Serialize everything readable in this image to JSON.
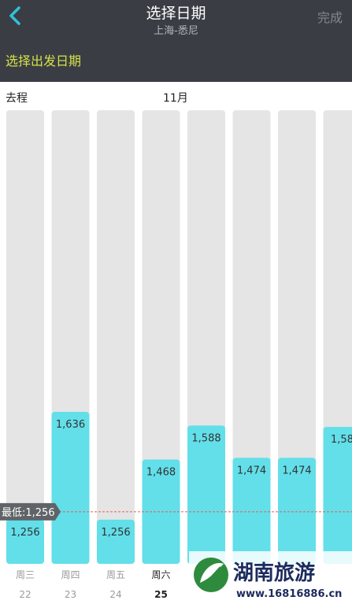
{
  "header": {
    "title": "选择日期",
    "subtitle": "上海-悉尼",
    "done_label": "完成",
    "prompt": "选择出发日期",
    "bg_color": "#3a3e44",
    "accent_color": "#d6e047",
    "back_icon": "chevron-left-icon",
    "back_icon_color": "#2ec3d8"
  },
  "section": {
    "leg_label": "去程",
    "month_label": "11月"
  },
  "lowest_tag": {
    "label": "最低:1,256"
  },
  "chart_data": {
    "type": "bar",
    "days": [
      "周三",
      "周四",
      "周五",
      "周六",
      "",
      "",
      "",
      ""
    ],
    "categories": [
      "22",
      "23",
      "24",
      "25",
      "",
      "",
      "",
      ""
    ],
    "values": [
      1256,
      1636,
      1256,
      1468,
      1588,
      1474,
      1474,
      1583
    ],
    "value_labels": [
      "1,256",
      "1,636",
      "1,256",
      "1,468",
      "1,588",
      "1,474",
      "1,474",
      "1,58"
    ],
    "selected_index": 3,
    "min_value": 1256,
    "bar_color": "#62dfe9",
    "track_color": "#e5e5e5"
  },
  "watermark": {
    "title": "湖南旅游",
    "url": "www.16816886.cn"
  }
}
